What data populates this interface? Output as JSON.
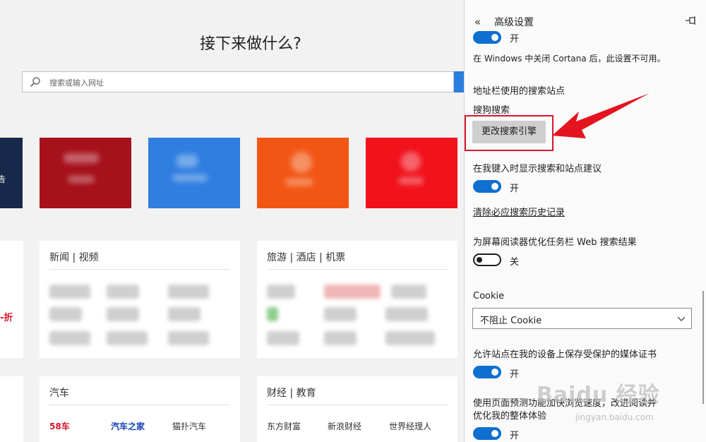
{
  "newtab": {
    "heading": "接下来做什么?",
    "search_placeholder": "搜索或输入网址",
    "left_sliver_char": "告",
    "left_sliver_red": "-折",
    "cards": [
      {
        "title": "新闻 | 视频"
      },
      {
        "title": "旅游 | 酒店 | 机票"
      },
      {
        "title": "汽车",
        "links": [
          "58车",
          "汽车之家",
          "猫扑汽车"
        ]
      },
      {
        "title": "财经 | 教育",
        "links": [
          "东方财富",
          "新浪财经",
          "世界经理人"
        ]
      }
    ]
  },
  "settings": {
    "title": "高级设置",
    "top_toggle_state": "开",
    "cortana_note": "在 Windows 中关闭 Cortana 后，此设置不可用。",
    "search_engine_label": "地址栏使用的搜索站点",
    "search_engine_value": "搜狗搜索",
    "change_engine_button": "更改搜索引擎",
    "suggestions_label": "在我键入时显示搜索和站点建议",
    "suggestions_state": "开",
    "clear_history_link": "清除必应搜索历史记录",
    "screenreader_label": "为屏幕阅读器优化任务栏 Web 搜索结果",
    "screenreader_state": "关",
    "cookie_label": "Cookie",
    "cookie_value": "不阻止 Cookie",
    "media_license_label": "允许站点在我的设备上保存受保护的媒体证书",
    "media_license_state": "开",
    "page_predict_label_line1": "使用页面预测功能加快浏览速度，改进阅读并",
    "page_predict_label_line2": "优化我的整体体验",
    "page_predict_state": "开"
  },
  "watermark": {
    "text": "Baidu 经验",
    "url": "jingyan.baidu.com"
  },
  "colors": {
    "accent": "#0f6fd1",
    "highlight": "#d7182a",
    "link": "#0b6bc7"
  }
}
